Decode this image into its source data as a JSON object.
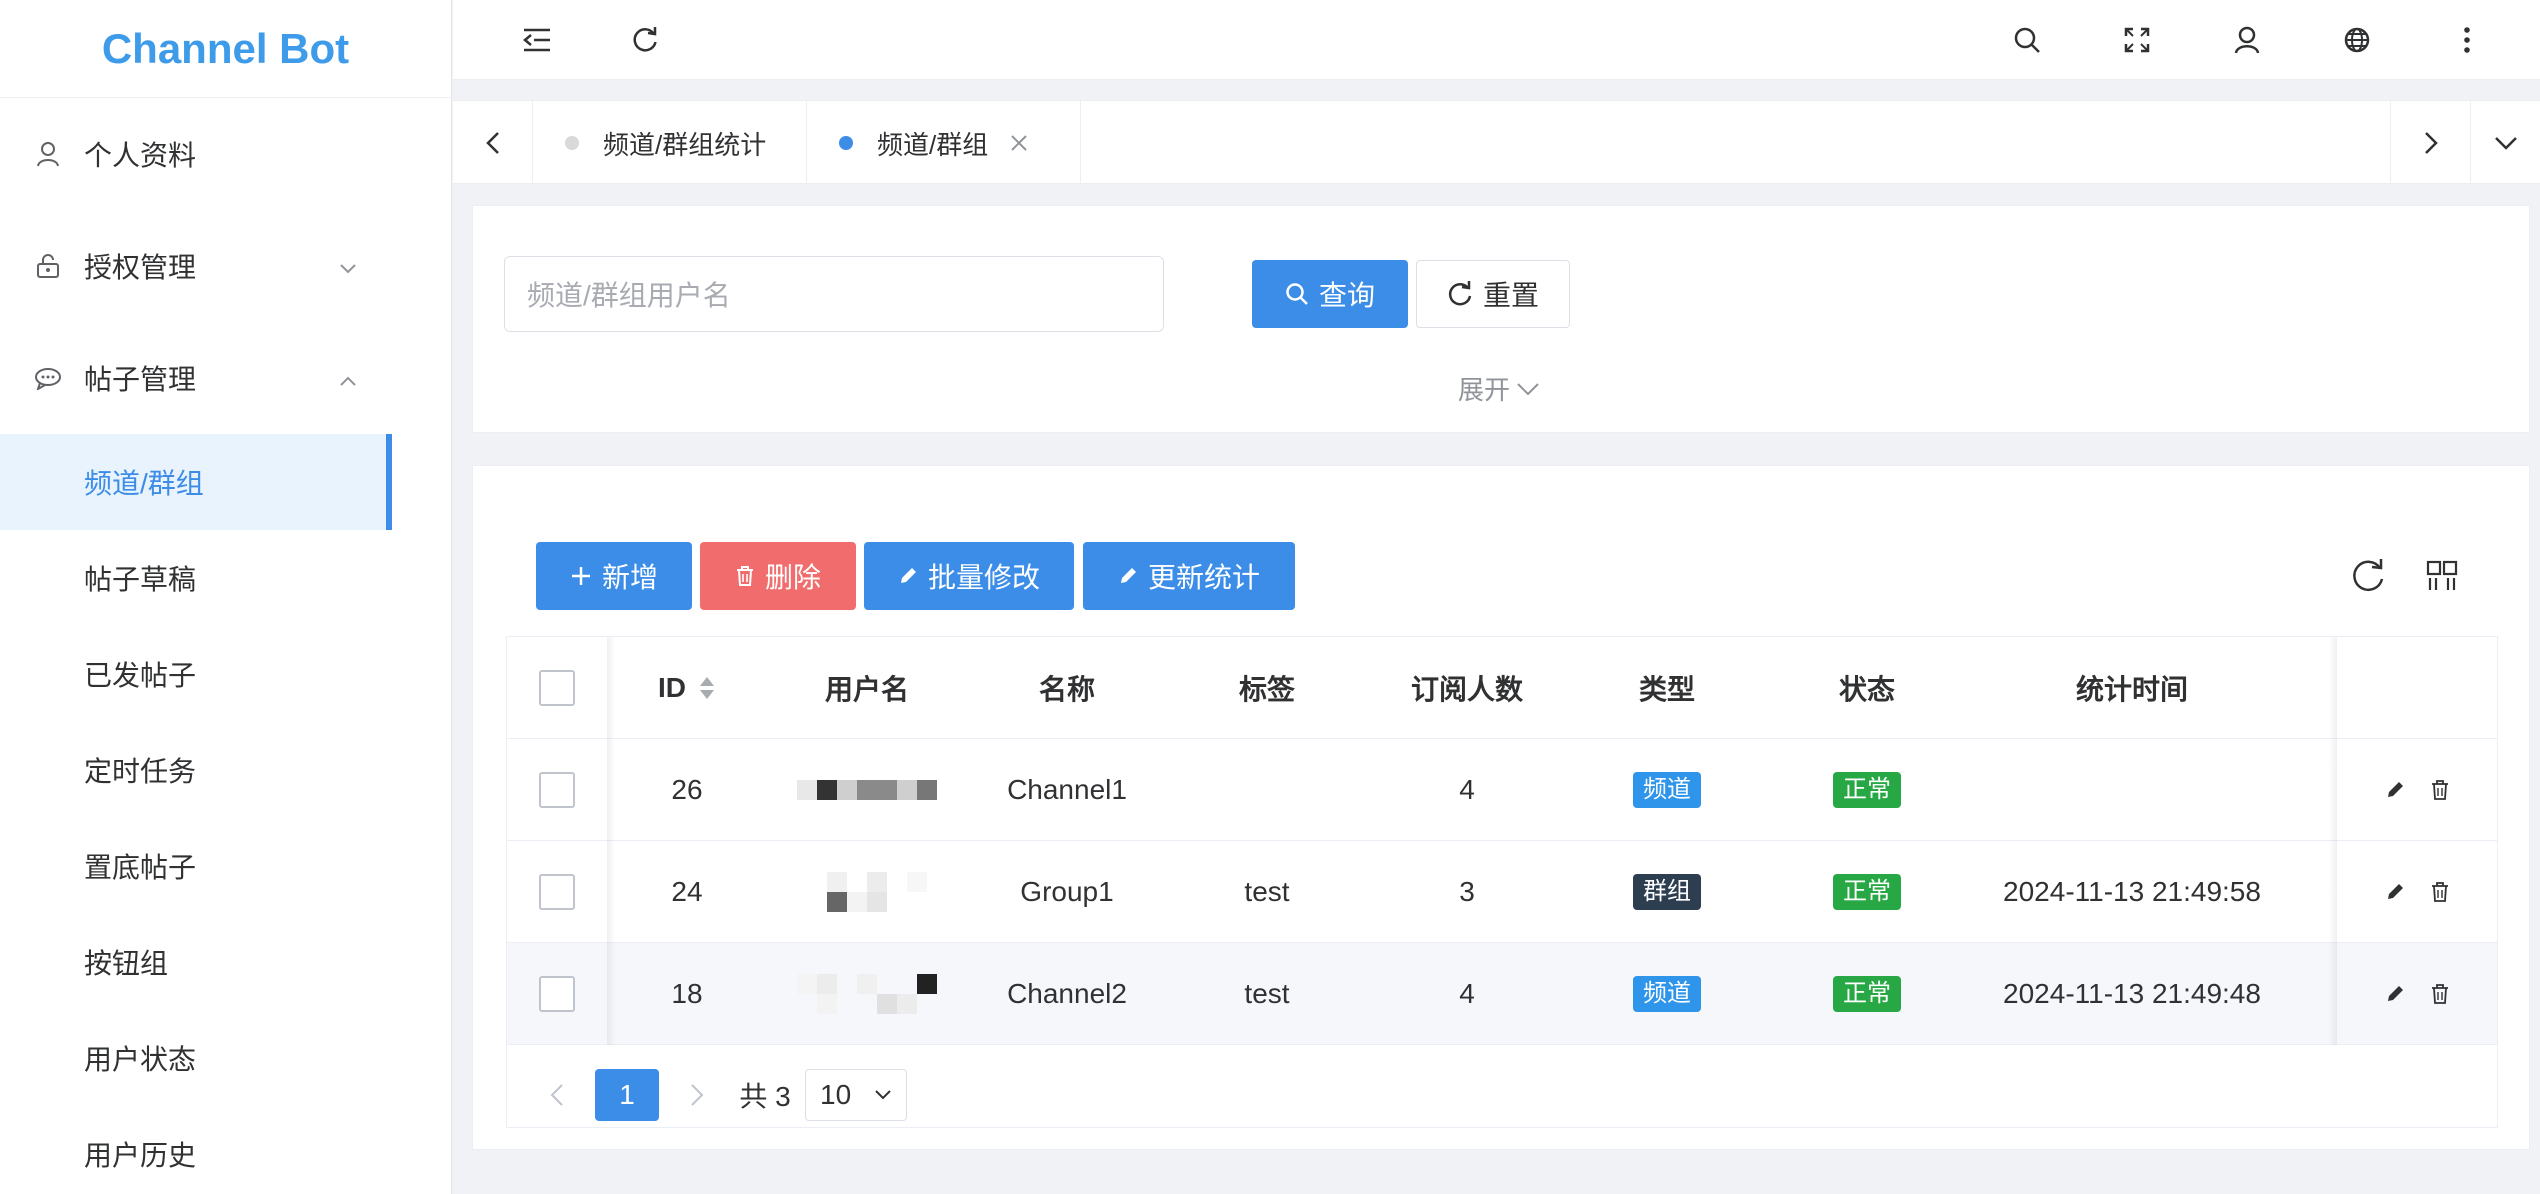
{
  "app": {
    "title": "Channel Bot"
  },
  "sidebar": {
    "items": [
      {
        "label": "个人资料",
        "icon": "user-icon"
      },
      {
        "label": "授权管理",
        "icon": "lock-icon",
        "expanded": false
      },
      {
        "label": "帖子管理",
        "icon": "chat-icon",
        "expanded": true
      }
    ],
    "subitems": [
      {
        "label": "频道/群组",
        "active": true
      },
      {
        "label": "帖子草稿"
      },
      {
        "label": "已发帖子"
      },
      {
        "label": "定时任务"
      },
      {
        "label": "置底帖子"
      },
      {
        "label": "按钮组"
      },
      {
        "label": "用户状态"
      },
      {
        "label": "用户历史"
      }
    ]
  },
  "header": {
    "icons": [
      "collapse-menu-icon",
      "refresh-icon",
      "search-icon",
      "fullscreen-icon",
      "user-icon",
      "globe-icon",
      "more-vertical-icon"
    ]
  },
  "tabs": [
    {
      "label": "频道/群组统计",
      "active": false
    },
    {
      "label": "频道/群组",
      "active": true,
      "closable": true
    }
  ],
  "search": {
    "placeholder": "频道/群组用户名",
    "query_label": "查询",
    "reset_label": "重置",
    "expand_label": "展开"
  },
  "toolbar": {
    "add_label": "新增",
    "delete_label": "删除",
    "batch_edit_label": "批量修改",
    "update_stats_label": "更新统计"
  },
  "table": {
    "columns": [
      "ID",
      "用户名",
      "名称",
      "标签",
      "订阅人数",
      "类型",
      "状态",
      "统计时间"
    ],
    "rows": [
      {
        "id": "26",
        "name": "Channel1",
        "tag": "",
        "subscribers": "4",
        "type": "频道",
        "status": "正常",
        "time": ""
      },
      {
        "id": "24",
        "name": "Group1",
        "tag": "test",
        "subscribers": "3",
        "type": "群组",
        "status": "正常",
        "time": "2024-11-13 21:49:58"
      },
      {
        "id": "18",
        "name": "Channel2",
        "tag": "test",
        "subscribers": "4",
        "type": "频道",
        "status": "正常",
        "time": "2024-11-13 21:49:48"
      }
    ]
  },
  "pagination": {
    "current_page": "1",
    "total_label": "共 3",
    "page_size": "10"
  },
  "colors": {
    "primary": "#3b8de8",
    "danger": "#f16d6d",
    "tag_channel": "#2f95ea",
    "tag_group": "#2c3e50",
    "tag_status": "#27a844"
  }
}
